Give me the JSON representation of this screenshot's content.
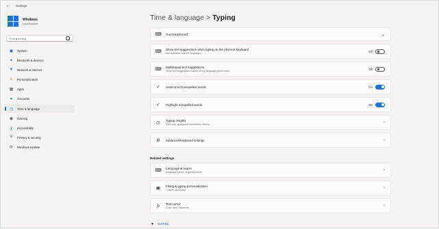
{
  "window": {
    "title": "Settings"
  },
  "profile": {
    "name": "Windows",
    "subtitle": "Local Account"
  },
  "search": {
    "placeholder": "Find a setting"
  },
  "sidebar": {
    "items": [
      {
        "label": "System",
        "icon": "monitor-icon"
      },
      {
        "label": "Bluetooth & devices",
        "icon": "bluetooth-icon"
      },
      {
        "label": "Network & internet",
        "icon": "wifi-icon"
      },
      {
        "label": "Personalization",
        "icon": "brush-icon"
      },
      {
        "label": "Apps",
        "icon": "apps-icon"
      },
      {
        "label": "Accounts",
        "icon": "person-icon"
      },
      {
        "label": "Time & language",
        "icon": "globe-clock-icon"
      },
      {
        "label": "Gaming",
        "icon": "gamepad-icon"
      },
      {
        "label": "Accessibility",
        "icon": "accessibility-icon"
      },
      {
        "label": "Privacy & security",
        "icon": "shield-icon"
      },
      {
        "label": "Windows Update",
        "icon": "update-icon"
      }
    ],
    "active_index": 6
  },
  "header": {
    "crumb": "Time & language",
    "separator": ">",
    "current": "Typing"
  },
  "settings": {
    "touch_keyboard": {
      "title": "Touch keyboard"
    },
    "text_suggestions_physical": {
      "title": "Show text suggestions when typing on the physical keyboard",
      "desc": "Not available in some languages",
      "state": "Off"
    },
    "multilingual": {
      "title": "Multilingual text suggestions",
      "desc": "Show text suggestions based on my language preferences",
      "state": "Off"
    },
    "autocorrect": {
      "title": "Autocorrect misspelled words",
      "state": "On"
    },
    "highlight": {
      "title": "Highlight misspelled words",
      "state": "On"
    },
    "insights": {
      "title": "Typing insights",
      "desc": "View your typing and corrections history"
    },
    "advanced_keyboard": {
      "title": "Advanced keyboard settings"
    }
  },
  "related": {
    "heading": "Related settings",
    "language_region": {
      "title": "Language & region",
      "desc": "Language packs, regional format"
    },
    "inking": {
      "title": "Inking & typing personalization",
      "desc": "Custom dictionary"
    },
    "text_cursor": {
      "title": "Text cursor",
      "desc": "Color, size, thickness"
    }
  },
  "help": {
    "label": "Get help"
  },
  "colors": {
    "accent": "#1e74cf",
    "background": "#f6f3f2",
    "card": "#fbfbfb"
  }
}
